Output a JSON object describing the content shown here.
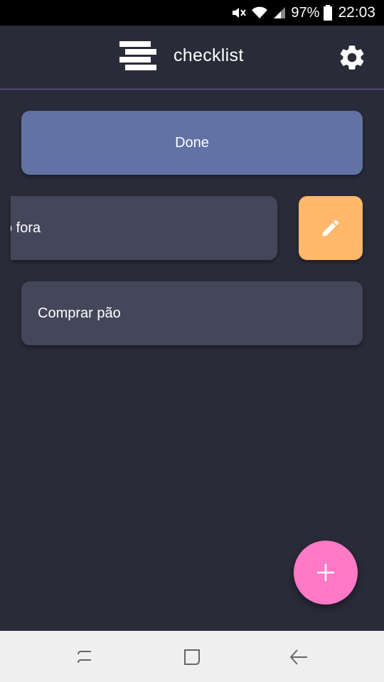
{
  "status_bar": {
    "battery": "97%",
    "time": "22:03",
    "icons": [
      "mute-icon",
      "wifi-icon",
      "signal-icon",
      "battery-icon"
    ]
  },
  "header": {
    "title": "checklist",
    "menu_icon": "menu-lines-icon",
    "settings_icon": "gear-icon"
  },
  "list": {
    "items": [
      {
        "label": "Done",
        "state": "done"
      },
      {
        "label": "o fora",
        "state": "swiped"
      },
      {
        "label": "Comprar pão",
        "state": "normal"
      }
    ],
    "edit_icon": "pencil-icon"
  },
  "fab": {
    "icon": "plus-icon"
  },
  "nav_bar": {
    "icons": [
      "recents-icon",
      "home-icon",
      "back-icon"
    ]
  },
  "colors": {
    "background": "#2a2b38",
    "done_item": "#6272a4",
    "item": "#44475a",
    "edit": "#ffb86c",
    "fab": "#ff79c6",
    "divider": "#7a5fc0"
  }
}
